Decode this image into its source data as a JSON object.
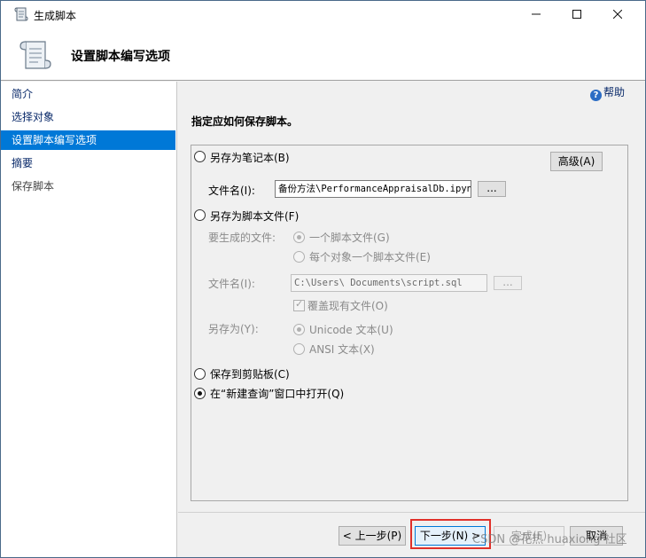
{
  "window": {
    "title": "生成脚本"
  },
  "header": {
    "title": "设置脚本编写选项"
  },
  "nav": {
    "items": [
      {
        "label": "简介"
      },
      {
        "label": "选择对象"
      },
      {
        "label": "设置脚本编写选项"
      },
      {
        "label": "摘要"
      },
      {
        "label": "保存脚本"
      }
    ]
  },
  "help": {
    "label": "帮助"
  },
  "content": {
    "section_title": "指定应如何保存脚本。",
    "save_as_notebook": {
      "label": "另存为笔记本(B)",
      "filename_label": "文件名(I):",
      "filename_value": "备份方法\\PerformanceAppraisalDb.ipynb",
      "browse_label": "...",
      "advanced_label": "高级(A)"
    },
    "save_as_script": {
      "label": "另存为脚本文件(F)",
      "files_to_generate_label": "要生成的文件:",
      "single_file_label": "一个脚本文件(G)",
      "per_object_label": "每个对象一个脚本文件(E)",
      "filename_label": "文件名(I):",
      "filename_value": "C:\\Users\\          Documents\\script.sql",
      "browse_label": "...",
      "overwrite_label": "覆盖现有文件(O)",
      "save_as_label": "另存为(Y):",
      "unicode_label": "Unicode 文本(U)",
      "ansi_label": "ANSI 文本(X)"
    },
    "clipboard_label": "保存到剪贴板(C)",
    "new_query_label": "在“新建查询”窗口中打开(Q)"
  },
  "footer": {
    "prev_label": "< 上一步(P)",
    "next_label": "下一步(N) >",
    "finish_label": "完成(F)",
    "cancel_label": "取消"
  },
  "watermark": "CSDN @花热 huaxiong 社区"
}
